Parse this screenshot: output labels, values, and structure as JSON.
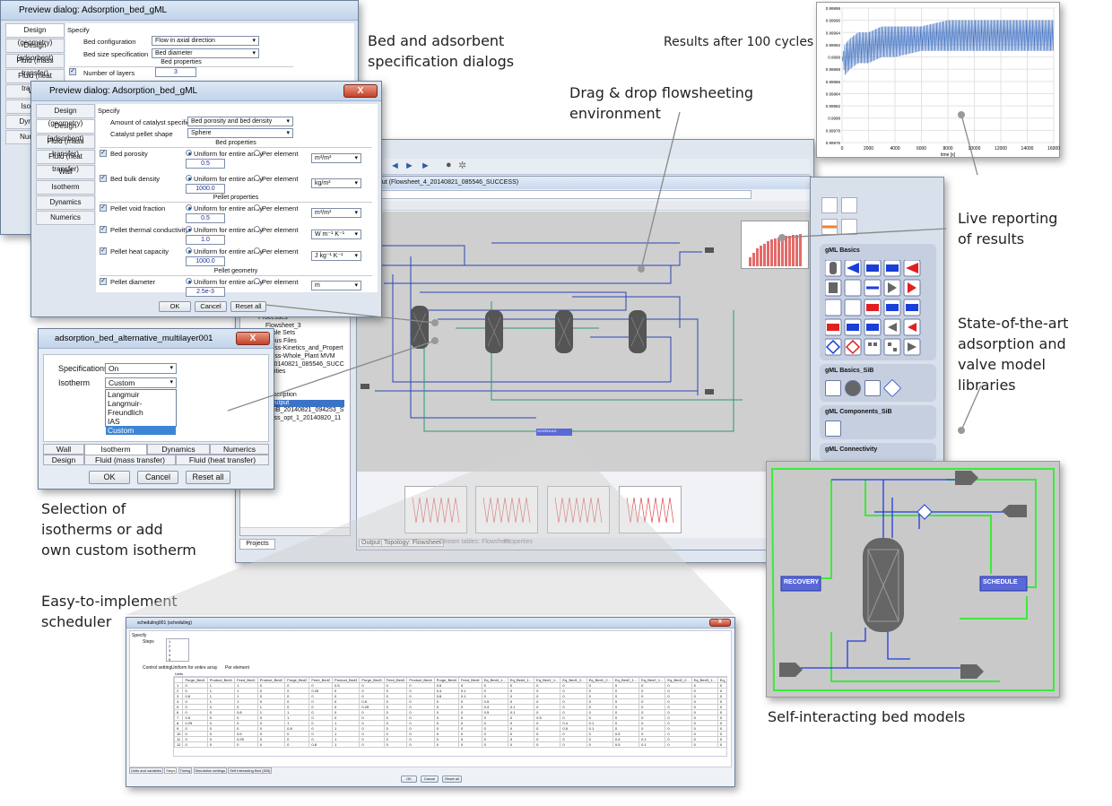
{
  "captions": {
    "bed_dialogs": [
      "Bed and adsorbent",
      "specification dialogs"
    ],
    "results_100": "Results after 100 cycles",
    "drag_drop": [
      "Drag & drop flowsheeting",
      "environment"
    ],
    "live_reporting": [
      "Live reporting",
      "of results"
    ],
    "libraries": [
      "State-of-the-art",
      "adsorption and",
      "valve model",
      "libraries"
    ],
    "isotherms": [
      "Selection of",
      "isotherms or add",
      "own custom isotherm"
    ],
    "scheduler": [
      "Easy-to-implement",
      "scheduler"
    ],
    "self_interacting": "Self-interacting bed models"
  },
  "dialog1": {
    "title": "Preview dialog: Adsorption_bed_gML",
    "tabs": [
      "Design (geometry)",
      "Design (adsorbent)",
      "Fluid (mass transfer)",
      "Fluid (heat transfer)",
      "Wall",
      "Isotherm",
      "Dynamics",
      "Numerics"
    ],
    "specify": "Specify",
    "bed_configuration_label": "Bed configuration",
    "bed_configuration_value": "Flow in axial direction",
    "bed_size_label": "Bed size specification",
    "bed_size_value": "Bed diameter",
    "bed_properties": "Bed properties",
    "layers_label": "Number of layers",
    "layers_value": "3"
  },
  "dialog2": {
    "title": "Preview dialog: Adsorption_bed_gML",
    "tabs": [
      "Design (geometry)",
      "Design (adsorbent)",
      "Fluid (mass transfer)",
      "Fluid (heat transfer)",
      "Wall",
      "Isotherm",
      "Dynamics",
      "Numerics"
    ],
    "specify": "Specify",
    "amount_label": "Amount of catalyst specification",
    "amount_value": "Bed porosity and bed density",
    "shape_label": "Catalyst pellet shape",
    "shape_value": "Sphere",
    "bed_properties": "Bed properties",
    "pellet_properties": "Pellet properties",
    "pellet_geometry": "Pellet geometry",
    "uniform": "Uniform for entire array",
    "per_element": "Per element",
    "rows": [
      {
        "label": "Bed porosity",
        "value": "0.5",
        "unit": "m³/m³"
      },
      {
        "label": "Bed bulk density",
        "value": "1000.0",
        "unit": "kg/m³"
      },
      {
        "label": "Pellet void fraction",
        "value": "0.5",
        "unit": "m³/m³"
      },
      {
        "label": "Pellet thermal conductivity",
        "value": "1.0",
        "unit": "W m⁻¹ K⁻¹"
      },
      {
        "label": "Pellet heat capacity",
        "value": "1000.0",
        "unit": "J kg⁻¹ K⁻¹"
      },
      {
        "label": "Pellet diameter",
        "value": "2.5e-3",
        "unit": "m"
      }
    ],
    "ok": "OK",
    "cancel": "Cancel",
    "reset": "Reset all"
  },
  "dialog3": {
    "title": "adsorption_bed_alternative_multilayer001 (adsorption_b...",
    "specifications_label": "Specifications",
    "specifications_value": "On",
    "isotherm_label": "Isotherm",
    "isotherm_value": "Custom",
    "options": [
      "Langmuir",
      "Langmuir-Freundlich",
      "IAS",
      "Custom"
    ],
    "tabs_row1": [
      "Wall",
      "Isotherm",
      "Dynamics",
      "Numerics"
    ],
    "tabs_row2": [
      "Design",
      "Fluid (mass transfer)",
      "Fluid (heat transfer)"
    ],
    "ok": "OK",
    "cancel": "Cancel",
    "reset": "Reset all"
  },
  "main_window": {
    "output_title": "on Output  (Flowsheet_4_20140821_085546_SUCCESS)",
    "field_value": "00",
    "tree_items": [
      "Processes",
      "Flowsheet_3",
      "Variable Sets",
      "llaneous Files",
      "Process-Kinetics_and_Propert",
      "Process-Whole_Plant MVM",
      "t_4_20140821_085546_SUCC",
      "al Entities",
      "ts",
      "ctory",
      "m Description",
      "tion Output",
      "t_4_SiB_20140821_094253_S",
      "process_opt_1_20140820_11"
    ],
    "projects_tab": "Projects",
    "bottom_tabs": [
      "Output",
      "Topology: Flowsheet",
      "Stream tables: Flowsheet",
      "Properties"
    ],
    "schedule_block": "SCHEDULE",
    "palette_groups": [
      "gML Basics",
      "gML Basics_SiB",
      "gML Components_SiB",
      "gML Connectivity"
    ]
  },
  "results_chart": {
    "xlabel": "time [s]"
  },
  "chart_data": {
    "type": "line",
    "xlabel": "time [s]",
    "ylabel": "",
    "xlim": [
      0,
      16000
    ],
    "ylim": [
      0.99976,
      0.99998
    ],
    "x_ticks": [
      0,
      2000,
      4000,
      6000,
      8000,
      10000,
      12000,
      14000,
      16000
    ],
    "y_ticks": [
      0.99976,
      0.99978,
      0.9998,
      0.99982,
      0.99984,
      0.99986,
      0.99988,
      0.9999,
      0.99992,
      0.99994,
      0.99996,
      0.99998
    ],
    "series": [
      {
        "x": [
          0,
          200,
          600,
          1200,
          2000,
          3000,
          4000,
          6000,
          8000,
          10000,
          12000,
          14000,
          16000
        ],
        "y": [
          0.9999,
          0.99992,
          0.99993,
          0.99994,
          0.99994,
          0.99995,
          0.99995,
          0.99995,
          0.99996,
          0.99996,
          0.99996,
          0.99996,
          0.99996
        ],
        "lower": [
          0.9999,
          0.99987,
          0.99988,
          0.99989,
          0.99989,
          0.9999,
          0.9999,
          0.99991,
          0.99991,
          0.99991,
          0.99991,
          0.99991,
          0.99991
        ]
      }
    ],
    "grid": true
  },
  "scheduler": {
    "title": "scheduling001 (scheduling)",
    "specify": "Specify",
    "steps_label": "Steps",
    "steps_values": [
      "1",
      "2",
      "3",
      "4",
      "5"
    ],
    "control_label": "Control setting",
    "uniform": "Uniform for entire array",
    "per_element": "Per element",
    "units_label": "Units",
    "columns": [
      "Purge_Bed1",
      "Product_Bed1",
      "Feed_Bed1",
      "Product_Bed2",
      "Purge_Bed2",
      "Feed_Bed2",
      "Product_Bed3",
      "Purge_Bed3",
      "Feed_Bed3",
      "Product_Bed4",
      "Purge_Bed4",
      "Feed_Bed4",
      "Eq_Bed4_1...",
      "Eq_Bed4_1...",
      "Eq_Bed1_1...",
      "Eq_Bed1_2...",
      "Eq_Bed1_2...",
      "Eq_Bed2_1...",
      "Eq_Bed2_1...",
      "Eq_Bed2_2...",
      "Eq_Bed3_1...",
      "Eq_Bed3_1...",
      "Eq_Bed3_2...",
      "Eq_Bed4_1..."
    ],
    "rows": [
      [
        "1",
        "0",
        "1",
        "1",
        "0",
        "0",
        "0",
        "0.5",
        "0",
        "0",
        "0",
        "0.5",
        "0",
        "0",
        "0",
        "0",
        "0",
        "0",
        "0",
        "0",
        "0",
        "0",
        "0",
        "0"
      ],
      [
        "2",
        "0",
        "1",
        "1",
        "0",
        "0",
        "0.25",
        "0",
        "0",
        "0",
        "0",
        "0.4",
        "0.1",
        "0",
        "0",
        "0",
        "0",
        "0",
        "0",
        "0",
        "0",
        "0",
        "0",
        "0"
      ],
      [
        "3",
        "0.8",
        "1",
        "1",
        "0",
        "0",
        "0",
        "0",
        "0",
        "0",
        "0",
        "0.8",
        "0.1",
        "0",
        "0",
        "0",
        "0",
        "0",
        "0",
        "0",
        "0",
        "0",
        "0",
        "0"
      ],
      [
        "4",
        "0",
        "1",
        "1",
        "0",
        "0",
        "0",
        "0",
        "0.5",
        "0",
        "0",
        "0",
        "0",
        "0.5",
        "0",
        "0",
        "0",
        "0",
        "0",
        "0",
        "0",
        "0",
        "0",
        "0"
      ],
      [
        "5",
        "0",
        "0",
        "0",
        "1",
        "0",
        "0",
        "0",
        "0.25",
        "0",
        "0",
        "0",
        "0",
        "0.4",
        "0.1",
        "0",
        "0",
        "0",
        "0",
        "0",
        "0",
        "0",
        "0",
        "0"
      ],
      [
        "6",
        "0",
        "0",
        "0.8",
        "1",
        "1",
        "0",
        "0",
        "0",
        "0",
        "0",
        "0",
        "0",
        "0.5",
        "0.1",
        "0",
        "0",
        "0",
        "0",
        "0",
        "0",
        "0",
        "0",
        "0"
      ],
      [
        "7",
        "0.5",
        "0",
        "0",
        "0",
        "1",
        "0",
        "0",
        "0",
        "0",
        "0",
        "0",
        "0",
        "0",
        "0",
        "0.5",
        "0",
        "0",
        "0",
        "0",
        "0",
        "0",
        "0",
        "0"
      ],
      [
        "8",
        "0.25",
        "0",
        "0",
        "0",
        "1",
        "0",
        "1",
        "0",
        "0",
        "0",
        "0",
        "0",
        "0",
        "0",
        "0",
        "0.4",
        "0.1",
        "0",
        "0",
        "0",
        "0",
        "0",
        "0"
      ],
      [
        "9",
        "0",
        "0",
        "0",
        "0",
        "0.8",
        "0",
        "1",
        "0",
        "0",
        "0",
        "0",
        "0",
        "0",
        "0",
        "0",
        "0.5",
        "0.1",
        "0",
        "0",
        "0",
        "0",
        "0",
        "0"
      ],
      [
        "10",
        "0",
        "0",
        "0.5",
        "0",
        "0",
        "0",
        "1",
        "0",
        "0",
        "0",
        "0",
        "0",
        "0",
        "0",
        "0",
        "0",
        "0",
        "0.5",
        "0",
        "0",
        "0",
        "0",
        "0"
      ],
      [
        "11",
        "0",
        "0",
        "0.25",
        "0",
        "0",
        "0",
        "1",
        "0",
        "0",
        "0",
        "0",
        "0",
        "0",
        "0",
        "0",
        "0",
        "0",
        "0.4",
        "0.1",
        "0",
        "0",
        "0",
        "0"
      ],
      [
        "12",
        "0",
        "0",
        "0",
        "0",
        "0",
        "0.8",
        "1",
        "0",
        "0",
        "0",
        "0",
        "0",
        "0",
        "0",
        "0",
        "0",
        "0",
        "0.5",
        "0.1",
        "0",
        "0",
        "0",
        "0"
      ]
    ],
    "bottom_tabs": [
      "Units and variables",
      "Steps",
      "Timing",
      "Simulation settings",
      "Self Interacting Bed (SIB)"
    ],
    "ok": "OK",
    "cancel": "Cancel",
    "reset": "Reset all"
  },
  "sib": {
    "recovery": "RECOVERY",
    "schedule": "SCHEDULE"
  }
}
